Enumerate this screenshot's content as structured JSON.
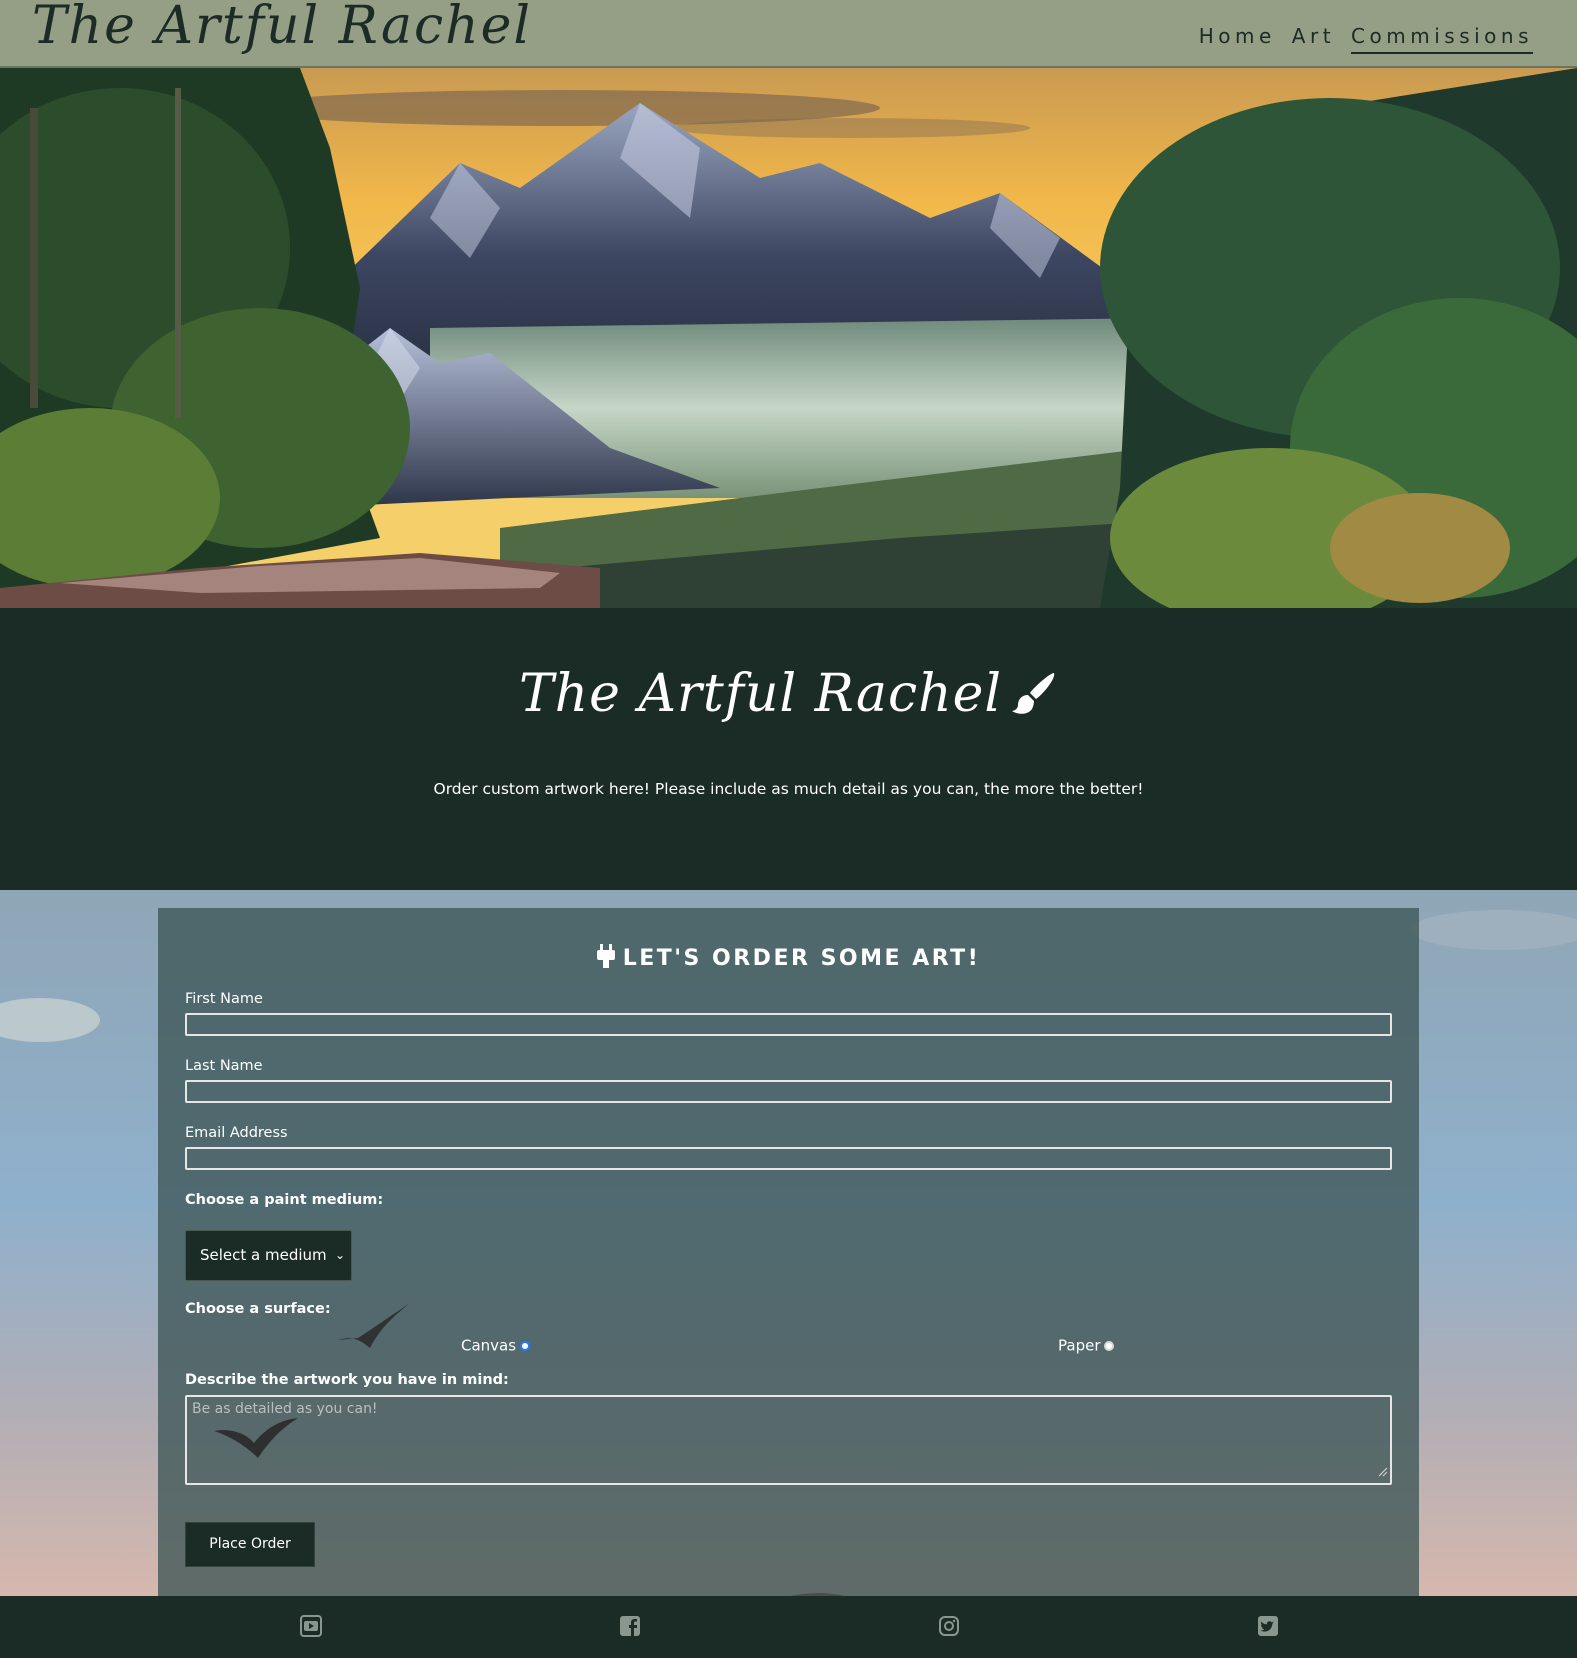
{
  "header": {
    "brand": "The Artful Rachel",
    "nav": [
      {
        "label": "Home",
        "active": false
      },
      {
        "label": "Art",
        "active": false
      },
      {
        "label": "Commissions",
        "active": true
      }
    ]
  },
  "intro": {
    "title": "The Artful Rachel",
    "description": "Order custom artwork here! Please include as much detail as you can, the more the better!"
  },
  "form": {
    "heading": "LET'S ORDER SOME ART!",
    "first_name_label": "First Name",
    "last_name_label": "Last Name",
    "email_label": "Email Address",
    "medium_label": "Choose a paint medium:",
    "medium_selected": "Select a medium",
    "surface_label": "Choose a surface:",
    "surface_options": [
      "Canvas",
      "Paper"
    ],
    "description_label": "Describe the artwork you have in mind:",
    "description_placeholder": "Be as detailed as you can!",
    "submit_label": "Place Order"
  },
  "footer": {
    "social_icons": [
      "youtube-icon",
      "facebook-icon",
      "instagram-icon",
      "twitter-icon"
    ]
  },
  "colors": {
    "header_bg": "#959f85",
    "dark_green": "#1b2c26",
    "form_overlay": "#3e5656",
    "radio_accent": "#1a7dff"
  }
}
